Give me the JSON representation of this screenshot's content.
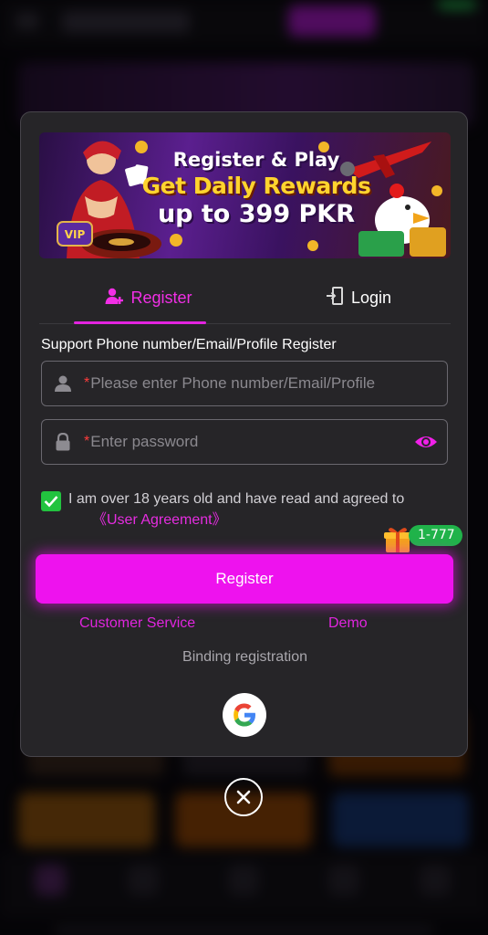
{
  "banner": {
    "line1": "Register & Play",
    "line2": "Get Daily Rewards",
    "line3": "up to 399 PKR",
    "vip_text": "VIP"
  },
  "tabs": [
    {
      "label": "Register",
      "active": true,
      "icon": "user-add-icon"
    },
    {
      "label": "Login",
      "active": false,
      "icon": "login-door-icon"
    }
  ],
  "form": {
    "support_label": "Support Phone number/Email/Profile Register",
    "username_placeholder": "Please enter Phone number/Email/Profile",
    "password_placeholder": "Enter password",
    "required_mark": "*",
    "agreement_text": "I am over 18 years old and have read and agreed to",
    "agreement_link": "《User Agreement》",
    "agreement_checked": true
  },
  "promo": {
    "badge": "1-777",
    "icon": "gift-icon"
  },
  "actions": {
    "register_button": "Register",
    "customer_service": "Customer Service",
    "demo": "Demo",
    "binding_label": "Binding registration"
  },
  "colors": {
    "accent": "#ee12ee",
    "link": "#e025de",
    "checkbox": "#22c33f",
    "badge": "#20b34a",
    "modal_bg": "#262528"
  }
}
